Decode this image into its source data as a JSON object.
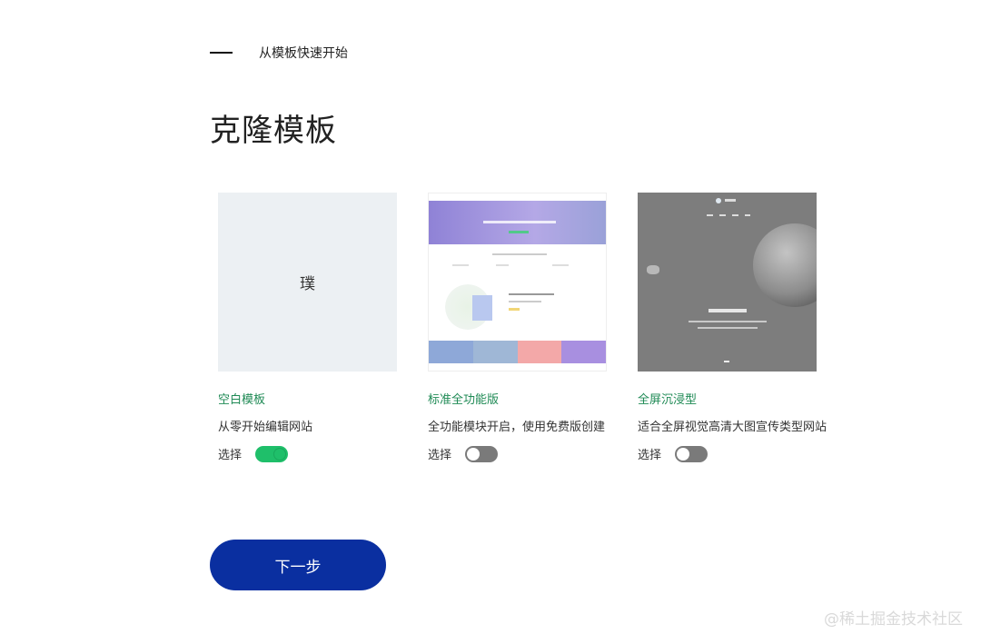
{
  "header": {
    "step_label": "从模板快速开始",
    "page_title": "克隆模板"
  },
  "cards": [
    {
      "thumb_text": "璞",
      "title": "空白模板",
      "desc": "从零开始编辑网站",
      "select_label": "选择",
      "selected": true
    },
    {
      "title": "标准全功能版",
      "desc": "全功能模块开启，使用免费版创建",
      "select_label": "选择",
      "selected": false
    },
    {
      "title": "全屏沉浸型",
      "desc": "适合全屏视觉高清大图宣传类型网站",
      "select_label": "选择",
      "selected": false
    }
  ],
  "actions": {
    "next_label": "下一步"
  },
  "watermark": "@稀土掘金技术社区",
  "colors": {
    "accent_green": "#1fbf6a",
    "title_green": "#1f8a55",
    "primary_blue": "#0a2fa0",
    "toggle_off": "#7a7a7a",
    "tile_colors": [
      "#8ea8d8",
      "#9fb7d6",
      "#f3a8a8",
      "#a88fe0"
    ]
  }
}
